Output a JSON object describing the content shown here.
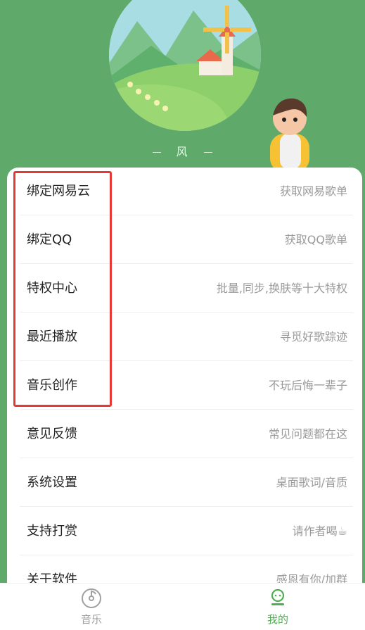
{
  "profile": {
    "username": "风"
  },
  "menu": [
    {
      "label": "绑定网易云",
      "value": "获取网易歌单"
    },
    {
      "label": "绑定QQ",
      "value": "获取QQ歌单"
    },
    {
      "label": "特权中心",
      "value": "批量,同步,换肤等十大特权"
    },
    {
      "label": "最近播放",
      "value": "寻觅好歌踪迹"
    },
    {
      "label": "音乐创作",
      "value": "不玩后悔一辈子"
    },
    {
      "label": "意见反馈",
      "value": "常见问题都在这"
    },
    {
      "label": "系统设置",
      "value": "桌面歌词/音质"
    },
    {
      "label": "支持打赏",
      "value": "请作者喝☕"
    },
    {
      "label": "关于软件",
      "value": "感恩有你/加群"
    }
  ],
  "nav": {
    "music_label": "音乐",
    "mine_label": "我的",
    "music_icon": "music-disc-icon",
    "mine_icon": "user-icon"
  },
  "colors": {
    "header_bg": "#5faa6a",
    "active": "#4caf50",
    "highlight": "#e53935"
  }
}
